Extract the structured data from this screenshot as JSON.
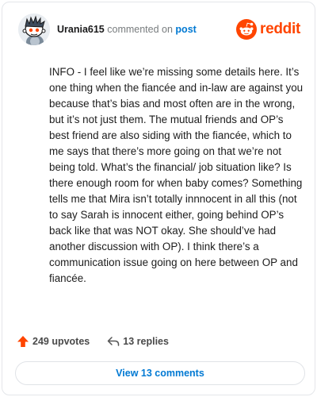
{
  "comment": {
    "username": "Urania615",
    "action_text": "commented on",
    "post_link_text": "post",
    "body": "INFO - I feel like we’re missing some details here. It’s one thing when the fiancée and in-law are against you because that’s bias and most often are in the wrong, but it’s not just them. The mutual friends and OP’s best friend are also siding with the fiancée, which to me says that there’s more going on that we’re not being told. What’s the financial/ job situation like? Is there enough room for when baby comes? Something tells me that Mira isn’t totally innnocent in all this (not to say Sarah is innocent either, going behind OP’s back like that was NOT okay. She should’ve had another discussion with OP). I think there’s a communication issue going on here between OP and fiancée.",
    "upvotes": "249 upvotes",
    "replies": "13 replies"
  },
  "brand": {
    "name": "reddit",
    "color": "#ff4500"
  },
  "icons": {
    "avatar": "snoo-avatar",
    "logo": "reddit-logo-icon",
    "upvote": "upvote-arrow-icon",
    "reply": "reply-arrow-icon"
  },
  "footer": {
    "view_comments_label": "View 13 comments"
  },
  "colors": {
    "link": "#0079d3",
    "accent": "#ff4500",
    "muted": "#787c7e"
  }
}
